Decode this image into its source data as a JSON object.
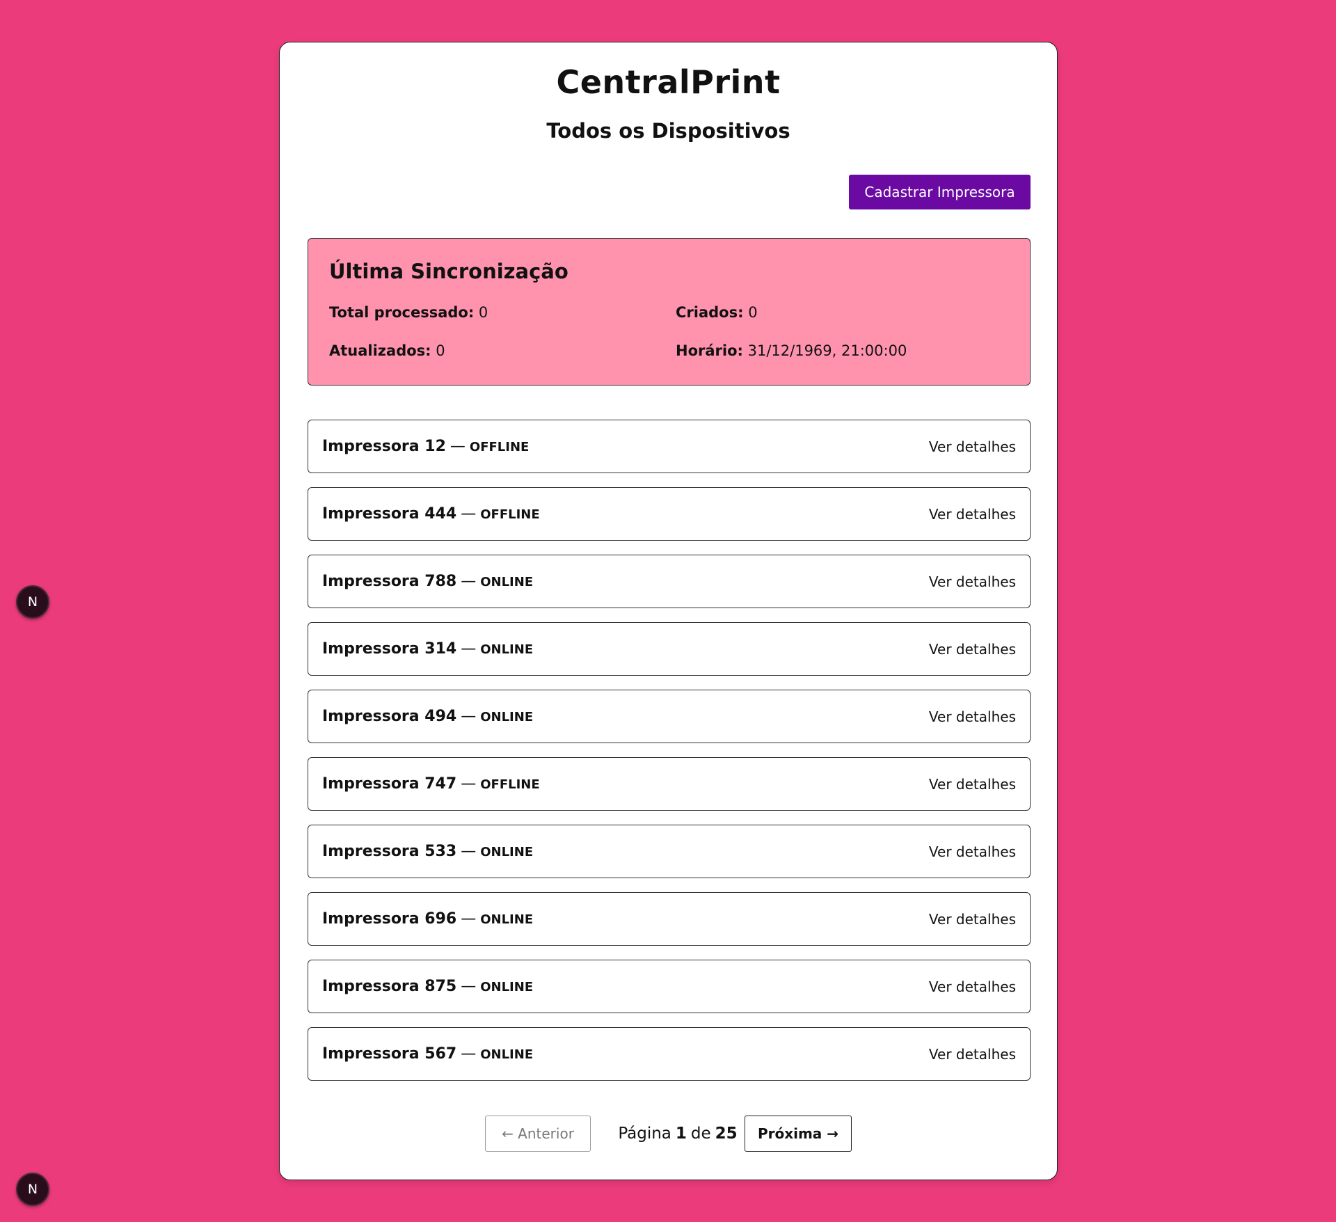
{
  "app": {
    "title": "CentralPrint",
    "subtitle": "Todos os Dispositivos",
    "add_button_label": "Cadastrar Impressora"
  },
  "sync": {
    "title": "Última Sincronização",
    "total_label": "Total processado:",
    "total_value": "0",
    "created_label": "Criados:",
    "created_value": "0",
    "updated_label": "Atualizados:",
    "updated_value": "0",
    "time_label": "Horário:",
    "time_value": "31/12/1969, 21:00:00"
  },
  "printers": [
    {
      "name": "Impressora 12",
      "status": "OFFLINE",
      "link": "Ver detalhes"
    },
    {
      "name": "Impressora 444",
      "status": "OFFLINE",
      "link": "Ver detalhes"
    },
    {
      "name": "Impressora 788",
      "status": "ONLINE",
      "link": "Ver detalhes"
    },
    {
      "name": "Impressora 314",
      "status": "ONLINE",
      "link": "Ver detalhes"
    },
    {
      "name": "Impressora 494",
      "status": "ONLINE",
      "link": "Ver detalhes"
    },
    {
      "name": "Impressora 747",
      "status": "OFFLINE",
      "link": "Ver detalhes"
    },
    {
      "name": "Impressora 533",
      "status": "ONLINE",
      "link": "Ver detalhes"
    },
    {
      "name": "Impressora 696",
      "status": "ONLINE",
      "link": "Ver detalhes"
    },
    {
      "name": "Impressora 875",
      "status": "ONLINE",
      "link": "Ver detalhes"
    },
    {
      "name": "Impressora 567",
      "status": "ONLINE",
      "link": "Ver detalhes"
    }
  ],
  "row_separator": "—",
  "pagination": {
    "prev_label": "← Anterior",
    "page_word": "Página",
    "current_page": "1",
    "of_word": "de",
    "total_pages": "25",
    "next_label": "Próxima →"
  },
  "dev_badges": [
    {
      "label": "N",
      "icon": "nextjs-icon"
    },
    {
      "label": "N",
      "icon": "nextjs-icon"
    }
  ],
  "colors": {
    "background": "#ec3b7b",
    "primary_button": "#6a0aa3",
    "sync_box": "#ff93ae"
  }
}
